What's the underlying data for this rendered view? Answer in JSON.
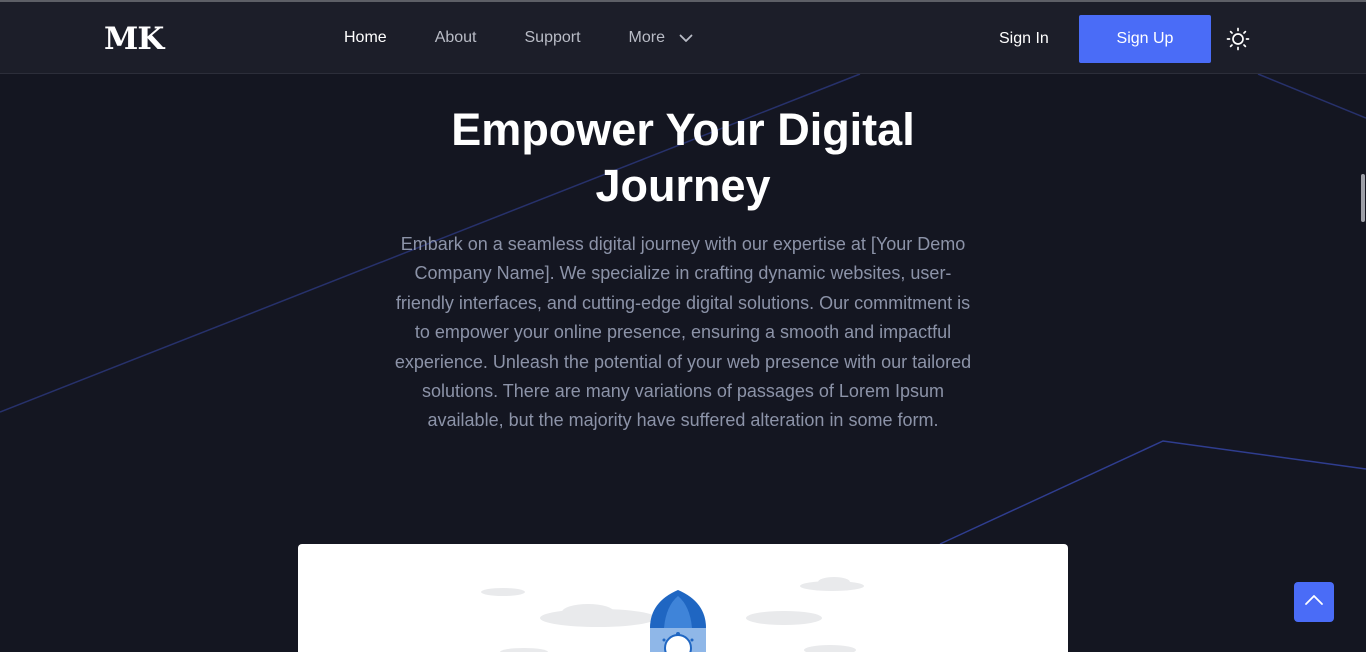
{
  "brand": {
    "logo_text": "MK"
  },
  "nav": {
    "links": [
      {
        "label": "Home",
        "active": true
      },
      {
        "label": "About",
        "active": false
      },
      {
        "label": "Support",
        "active": false
      },
      {
        "label": "More",
        "active": false,
        "icon": "chevron-down-icon"
      }
    ],
    "sign_in_label": "Sign In",
    "sign_up_label": "Sign Up",
    "theme_toggle_icon": "sun-icon"
  },
  "hero": {
    "title_line1": "Empower Your Digital",
    "title_line2": "Journey",
    "paragraph": "Embark on a seamless digital journey with our expertise at [Your Demo Company Name]. We specialize in crafting dynamic websites, user-friendly interfaces, and cutting-edge digital solutions. Our commitment is to empower your online presence, ensuring a smooth and impactful experience. Unleash the potential of your web presence with our tailored solutions. There are many variations of passages of Lorem Ipsum available, but the majority have suffered alteration in some form."
  },
  "illustration": {
    "icon": "rocket-icon"
  },
  "back_to_top": {
    "icon": "chevron-up-icon"
  },
  "colors": {
    "accent": "#4a6cf7",
    "background": "#141621",
    "navbar": "#1c1e29",
    "muted_text": "#8c93a8"
  }
}
